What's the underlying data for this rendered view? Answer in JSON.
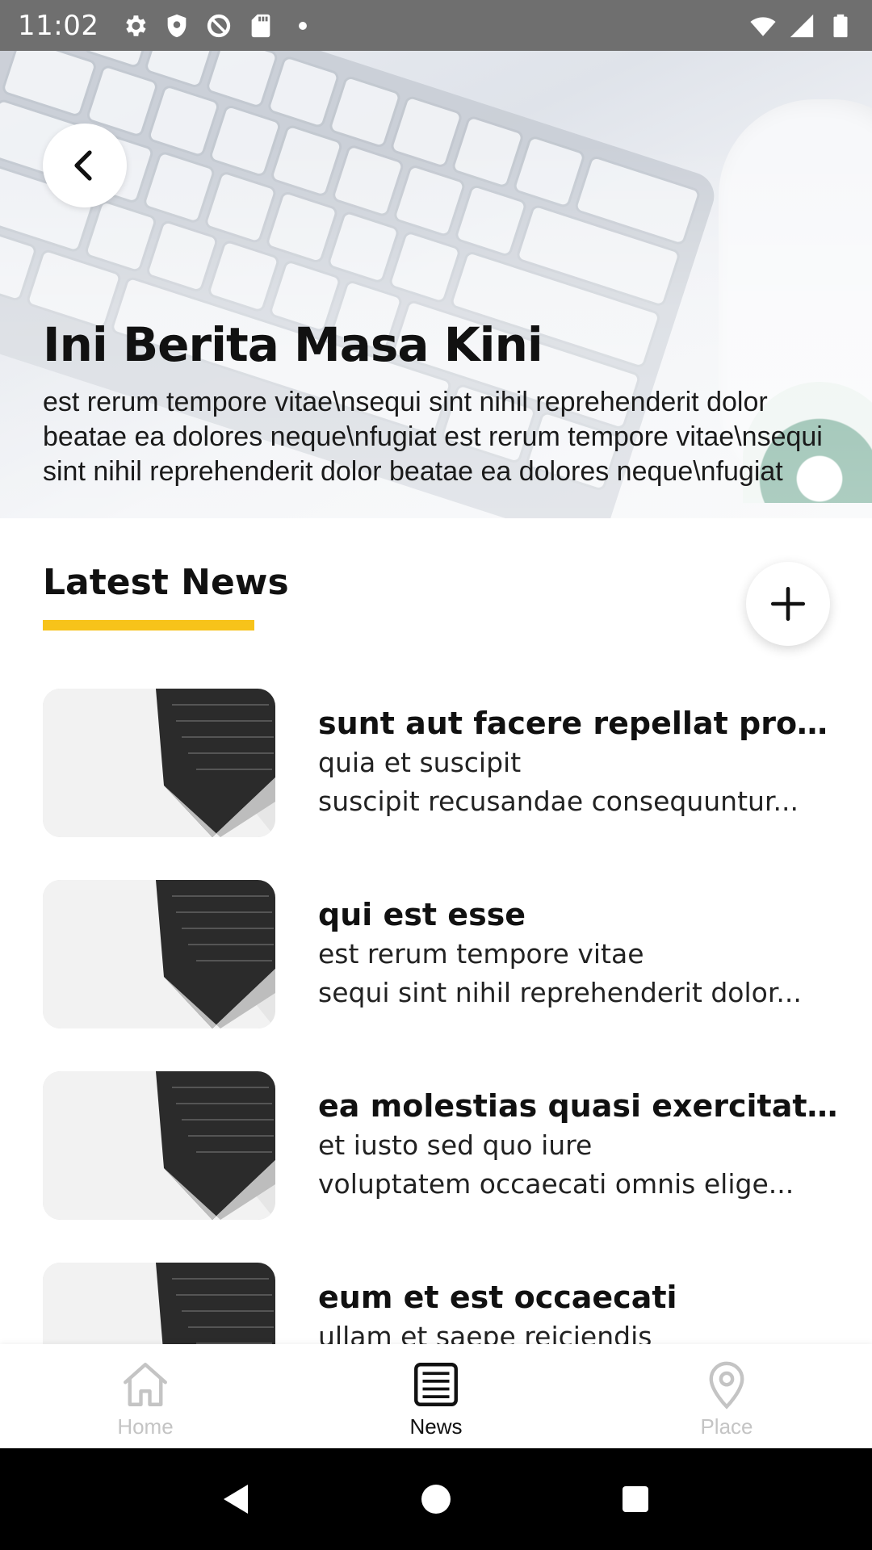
{
  "status_bar": {
    "time": "11:02",
    "left_icons": [
      "settings-icon",
      "shield-icon",
      "at-sign-icon",
      "sd-card-icon",
      "dot-icon"
    ],
    "right_icons": [
      "wifi-icon",
      "signal-icon",
      "battery-icon"
    ]
  },
  "hero": {
    "title": "Ini Berita Masa Kini",
    "body": "est rerum tempore vitae\\nsequi sint nihil reprehenderit dolor beatae ea dolores neque\\nfugiat est rerum tempore vitae\\nsequi sint nihil reprehenderit dolor beatae ea dolores neque\\nfugiat"
  },
  "section": {
    "title": "Latest News"
  },
  "news": [
    {
      "title": "sunt aut facere repellat provi...",
      "line1": "quia et suscipit",
      "line2": "suscipit recusandae consequuntur..."
    },
    {
      "title": "qui est esse",
      "line1": "est rerum tempore vitae",
      "line2": "sequi sint nihil reprehenderit dolor..."
    },
    {
      "title": "ea molestias quasi exercitati...",
      "line1": "et iusto sed quo iure",
      "line2": "voluptatem occaecati omnis elige..."
    },
    {
      "title": "eum et est occaecati",
      "line1": "ullam et saepe reiciendis",
      "line2": ""
    }
  ],
  "bottom_nav": {
    "items": [
      {
        "label": "Home",
        "icon": "home-icon",
        "active": false
      },
      {
        "label": "News",
        "icon": "newspaper-icon",
        "active": true
      },
      {
        "label": "Place",
        "icon": "map-pin-icon",
        "active": false
      }
    ]
  },
  "colors": {
    "accent_underline": "#f7c31a",
    "status_bar": "#6f6f6f",
    "inactive_nav": "#c4c4c4"
  }
}
